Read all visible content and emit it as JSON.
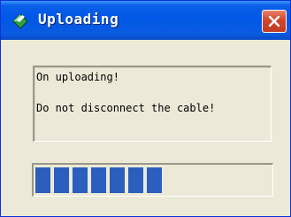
{
  "window": {
    "title": "Uploading",
    "title_icon": "green-diamond-icon",
    "close_icon": "close-icon"
  },
  "message": {
    "line_1": "On uploading!",
    "line_2": "Do not disconnect the cable!"
  },
  "progress": {
    "fraction": 0.54
  },
  "colors": {
    "titlebar": "#0058e6",
    "window_background": "#ece9d8",
    "progress_fill": "#2c5fbd",
    "close_button": "#d1462d"
  }
}
